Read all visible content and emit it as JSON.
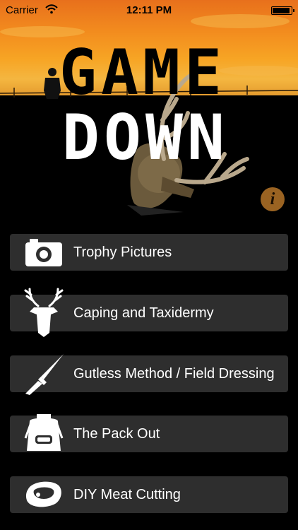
{
  "status_bar": {
    "carrier": "Carrier",
    "time": "12:11 PM",
    "wifi_icon": "wifi-icon",
    "battery_icon": "battery-icon"
  },
  "hero": {
    "logo_line1": "GAME",
    "logo_line2": "DOWN",
    "info_label": "i",
    "colors": {
      "sky_top": "#e8701c",
      "sky_bottom": "#f4b640",
      "ground": "#000000"
    }
  },
  "menu": {
    "items": [
      {
        "label": "Trophy Pictures",
        "icon": "camera-icon"
      },
      {
        "label": "Caping and Taxidermy",
        "icon": "deer-head-icon"
      },
      {
        "label": "Gutless Method / Field Dressing",
        "icon": "knife-icon"
      },
      {
        "label": "The Pack Out",
        "icon": "backpack-icon"
      },
      {
        "label": "DIY Meat Cutting",
        "icon": "steak-icon"
      }
    ],
    "colors": {
      "button_bg": "#2e2e2e",
      "text": "#ffffff"
    }
  }
}
